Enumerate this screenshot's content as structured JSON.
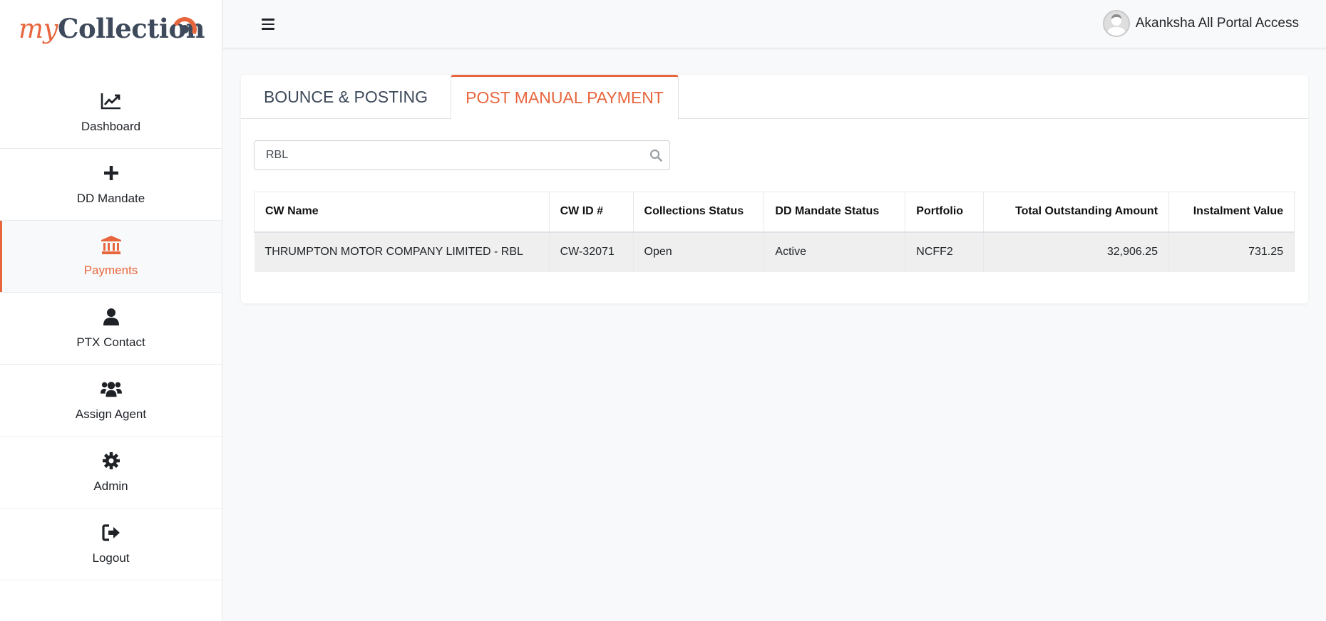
{
  "brand": {
    "my": "my",
    "collection": "Collection"
  },
  "sidebar": {
    "items": [
      {
        "label": "Dashboard",
        "icon": "chart-line-icon"
      },
      {
        "label": "DD Mandate",
        "icon": "plus-icon"
      },
      {
        "label": "Payments",
        "icon": "bank-icon",
        "active": true
      },
      {
        "label": "PTX Contact",
        "icon": "user-icon"
      },
      {
        "label": "Assign Agent",
        "icon": "users-icon"
      },
      {
        "label": "Admin",
        "icon": "gear-icon"
      },
      {
        "label": "Logout",
        "icon": "sign-out-icon"
      }
    ]
  },
  "header": {
    "user_name": "Akanksha All Portal Access"
  },
  "tabs": [
    {
      "label": "BOUNCE & POSTING",
      "active": false
    },
    {
      "label": "POST MANUAL PAYMENT",
      "active": true
    }
  ],
  "search": {
    "value": "RBL"
  },
  "table": {
    "columns": [
      "CW Name",
      "CW ID #",
      "Collections Status",
      "DD Mandate Status",
      "Portfolio",
      "Total Outstanding Amount",
      "Instalment Value"
    ],
    "rows": [
      [
        "THRUMPTON MOTOR COMPANY LIMITED - RBL",
        "CW-32071",
        "Open",
        "Active",
        "NCFF2",
        "32,906.25",
        "731.25"
      ]
    ]
  },
  "colors": {
    "accent": "#e8663d",
    "brand_dark": "#3e4a5b"
  }
}
